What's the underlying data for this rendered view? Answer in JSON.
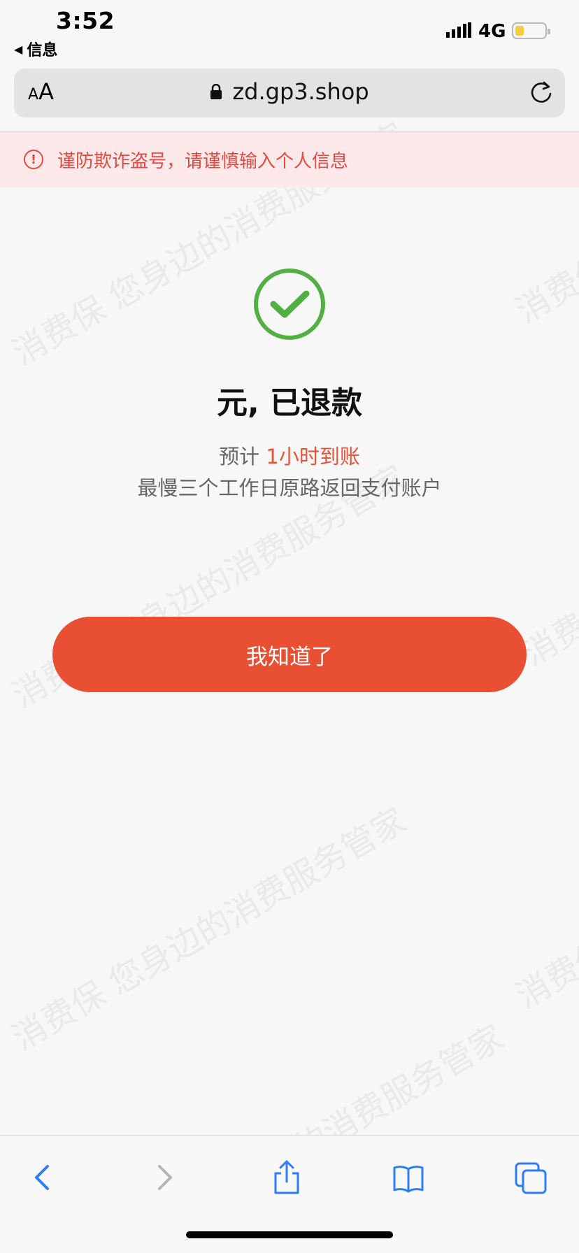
{
  "status_bar": {
    "time": "3:52",
    "back_label": "信息",
    "network": "4G",
    "battery_color": "#f7cc45"
  },
  "url_bar": {
    "text_size_label_small": "A",
    "text_size_label_large": "A",
    "url": "zd.gp3.shop",
    "lock_icon": "lock-icon",
    "reload_icon": "reload-icon"
  },
  "warning": {
    "icon": "!",
    "text": "谨防欺诈盗号，请谨慎输入个人信息",
    "color": "#e34b42"
  },
  "result": {
    "icon": "check-circle-icon",
    "title": "元, 已退款",
    "estimate_prefix": "预计",
    "estimate_highlight": "1小时到账",
    "note": "最慢三个工作日原路返回支付账户",
    "accent_color": "#e9533a"
  },
  "button": {
    "label": "我知道了",
    "color": "#e95033"
  },
  "watermark": {
    "text_a": "消费保 您身边的消费服务管家",
    "text_b": "消费保"
  },
  "toolbar": {
    "icons": [
      "back-icon",
      "forward-icon",
      "share-icon",
      "bookmarks-icon",
      "tabs-icon"
    ],
    "tint": "#2f7cf6"
  }
}
